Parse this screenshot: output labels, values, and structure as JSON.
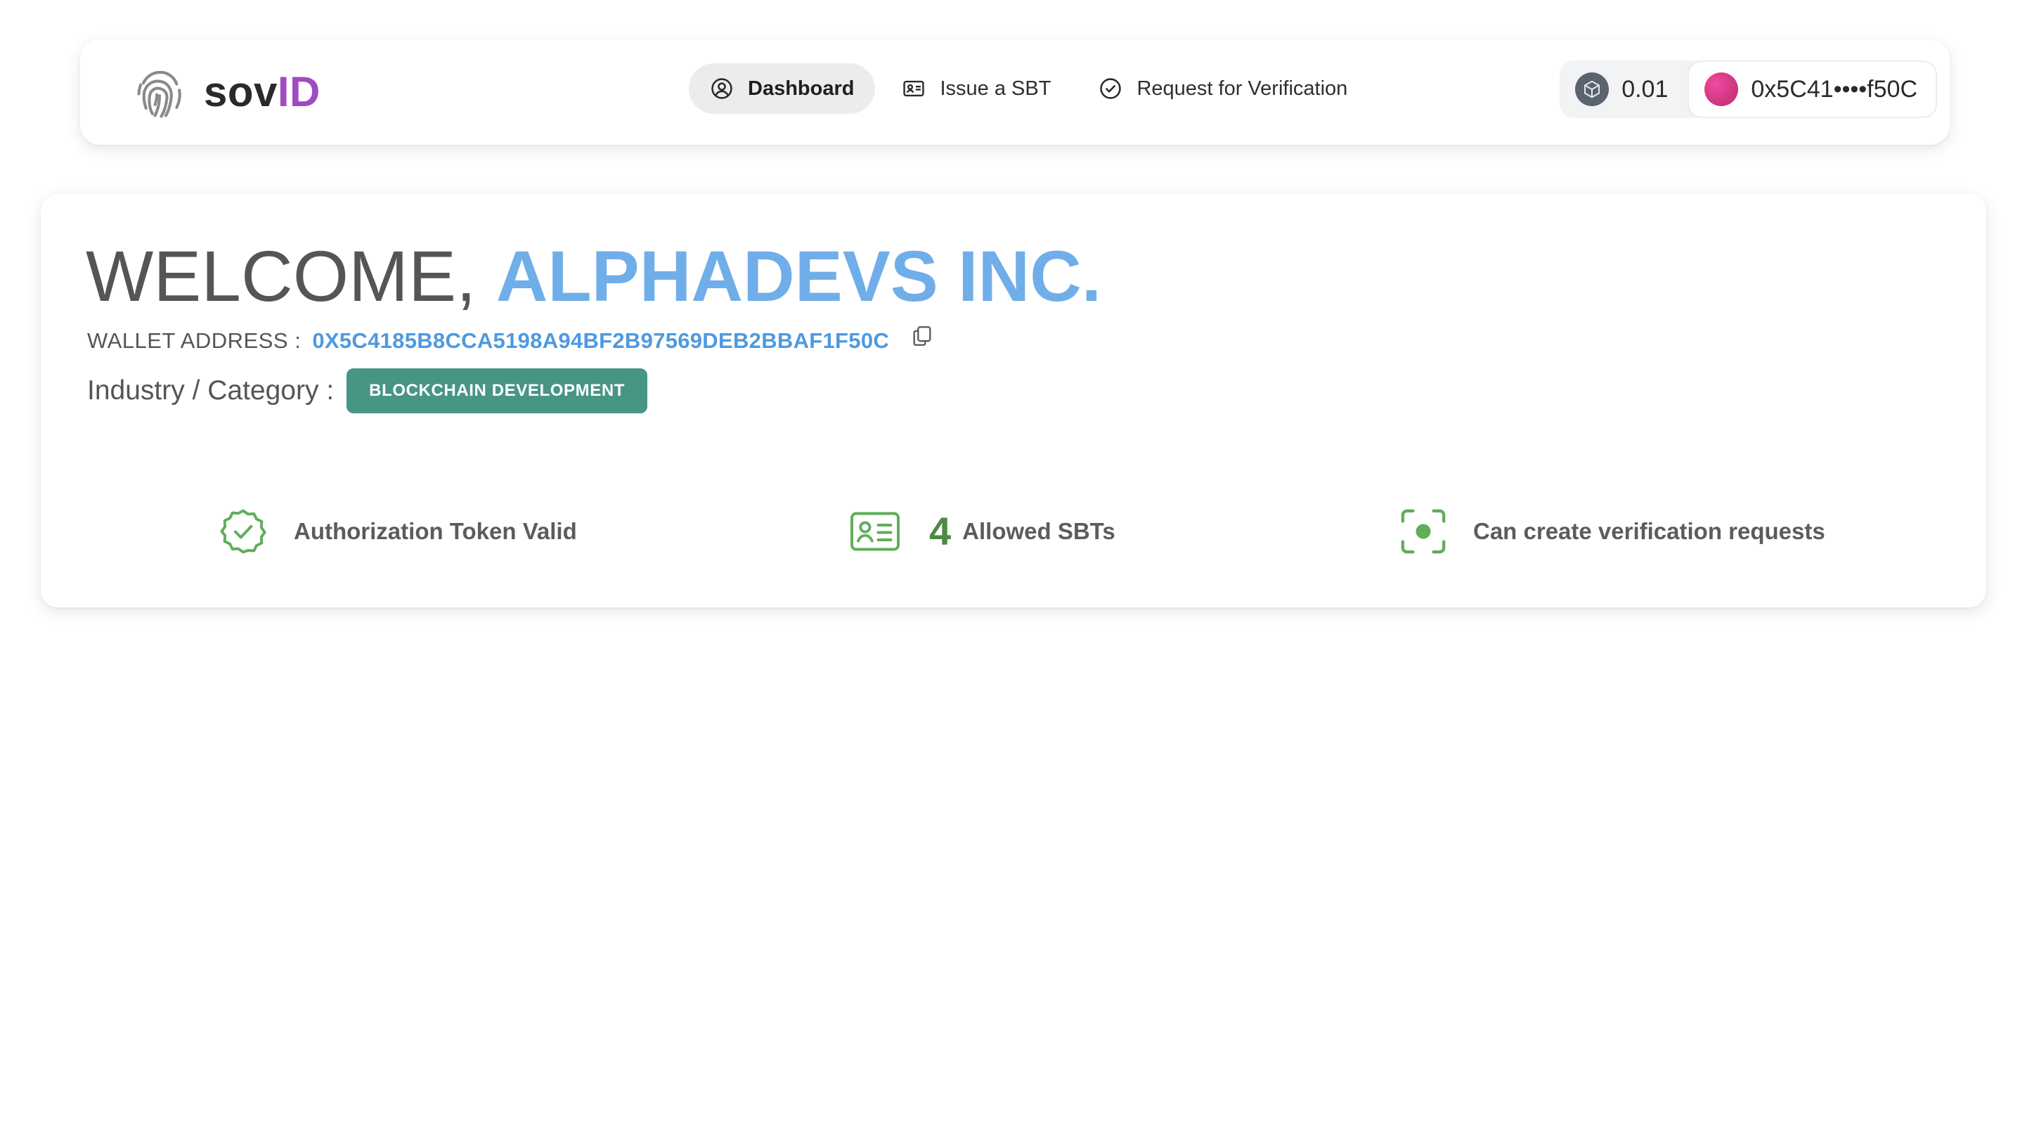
{
  "brand": {
    "prefix": "sov",
    "suffix": "ID",
    "logo_icon": "fingerprint-icon"
  },
  "nav": {
    "items": [
      {
        "label": "Dashboard",
        "icon": "user-circle-icon",
        "active": true
      },
      {
        "label": "Issue a SBT",
        "icon": "id-card-icon",
        "active": false
      },
      {
        "label": "Request for Verification",
        "icon": "check-circle-icon",
        "active": false
      }
    ]
  },
  "wallet": {
    "balance": "0.01",
    "balance_icon": "eth-cube-icon",
    "account": "0x5C41••••f50C"
  },
  "welcome": {
    "prefix": "WELCOME, ",
    "name": "ALPHADEVS INC.",
    "wallet_label": "WALLET ADDRESS :",
    "wallet_address": "0X5C4185B8CCA5198A94BF2B97569DEB2BBAF1F50C",
    "industry_label": "Industry / Category :",
    "industry_value": "BLOCKCHAIN DEVELOPMENT"
  },
  "stats": {
    "auth": {
      "text": "Authorization Token Valid",
      "icon": "verified-badge-icon"
    },
    "sbts": {
      "count": "4",
      "text": "Allowed SBTs",
      "icon": "id-card-icon"
    },
    "verify": {
      "text": "Can create verification requests",
      "icon": "scan-focus-icon"
    }
  },
  "colors": {
    "accent_blue": "#70aee9",
    "address_blue": "#4e99e0",
    "brand_purple": "#a04bc0",
    "badge_teal": "#479585",
    "stat_green": "#5fae5a"
  }
}
